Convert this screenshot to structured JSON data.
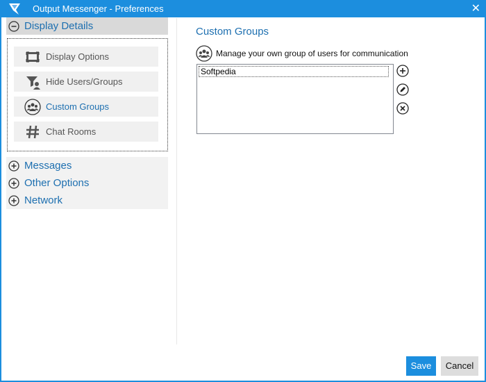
{
  "window": {
    "title": "Output Messenger - Preferences",
    "close_glyph": "✕",
    "accent_color": "#1c8ede"
  },
  "sidebar": {
    "active_section": {
      "label": "Display Details",
      "icon": "minus-circle-icon",
      "items": [
        {
          "label": "Display Options",
          "icon": "display-icon"
        },
        {
          "label": "Hide Users/Groups",
          "icon": "filter-users-icon"
        },
        {
          "label": "Custom Groups",
          "icon": "group-icon",
          "selected": true
        },
        {
          "label": "Chat Rooms",
          "icon": "hash-icon"
        }
      ]
    },
    "collapsed_sections": [
      {
        "label": "Messages",
        "icon": "plus-circle-icon"
      },
      {
        "label": "Other Options",
        "icon": "plus-circle-icon"
      },
      {
        "label": "Network",
        "icon": "plus-circle-icon"
      }
    ]
  },
  "content": {
    "title": "Custom Groups",
    "description": "Manage your own group of users for communication",
    "description_icon": "group-icon",
    "groups": [
      "Softpedia"
    ],
    "actions": [
      {
        "name": "add",
        "icon": "plus-circle-icon"
      },
      {
        "name": "edit",
        "icon": "pencil-circle-icon"
      },
      {
        "name": "delete",
        "icon": "x-circle-icon"
      }
    ]
  },
  "footer": {
    "save_label": "Save",
    "cancel_label": "Cancel"
  }
}
